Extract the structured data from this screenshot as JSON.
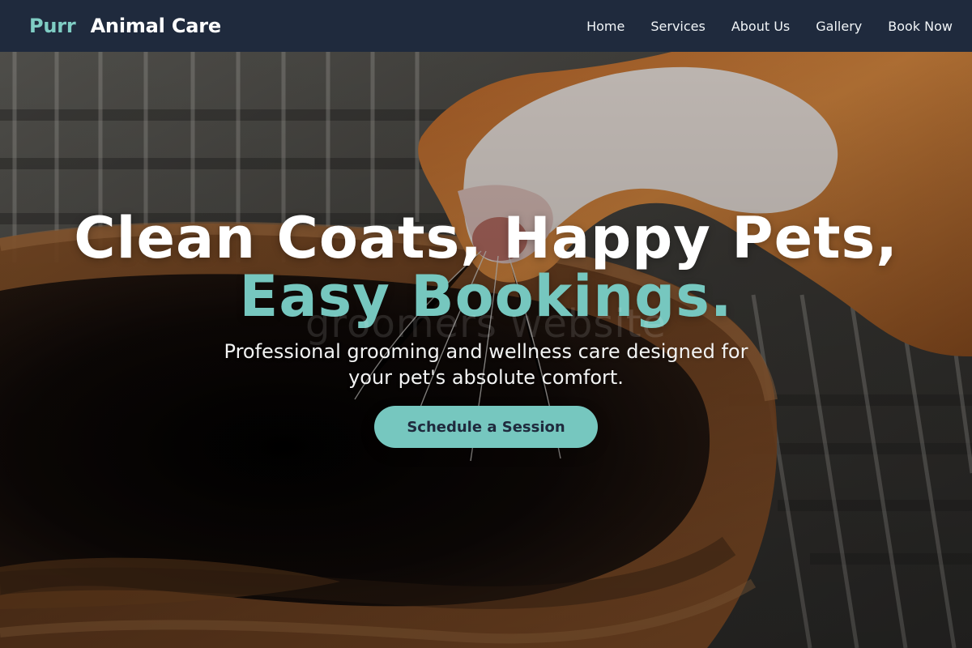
{
  "brand": {
    "purr": "Purr",
    "animal_care": "Animal Care"
  },
  "nav": {
    "items": [
      {
        "label": "Home"
      },
      {
        "label": "Services"
      },
      {
        "label": "About Us"
      },
      {
        "label": "Gallery"
      },
      {
        "label": "Book Now"
      }
    ]
  },
  "hero": {
    "headline_line_1": "Clean Coats, Happy Pets,",
    "headline_line_2": "Easy Bookings.",
    "watermark": "groomers website",
    "subtitle": "Professional grooming and wellness care designed for your pet's absolute comfort.",
    "cta_label": "Schedule a Session",
    "image_subject": "guinea-pig-drinking-from-clay-bowl"
  },
  "colors": {
    "navbar_background": "#1f2a3d",
    "brand_accent": "#7fcdc4",
    "headline_accent": "#76c7bf",
    "cta_background": "#76c7bf",
    "cta_text": "#1f2a3d"
  }
}
